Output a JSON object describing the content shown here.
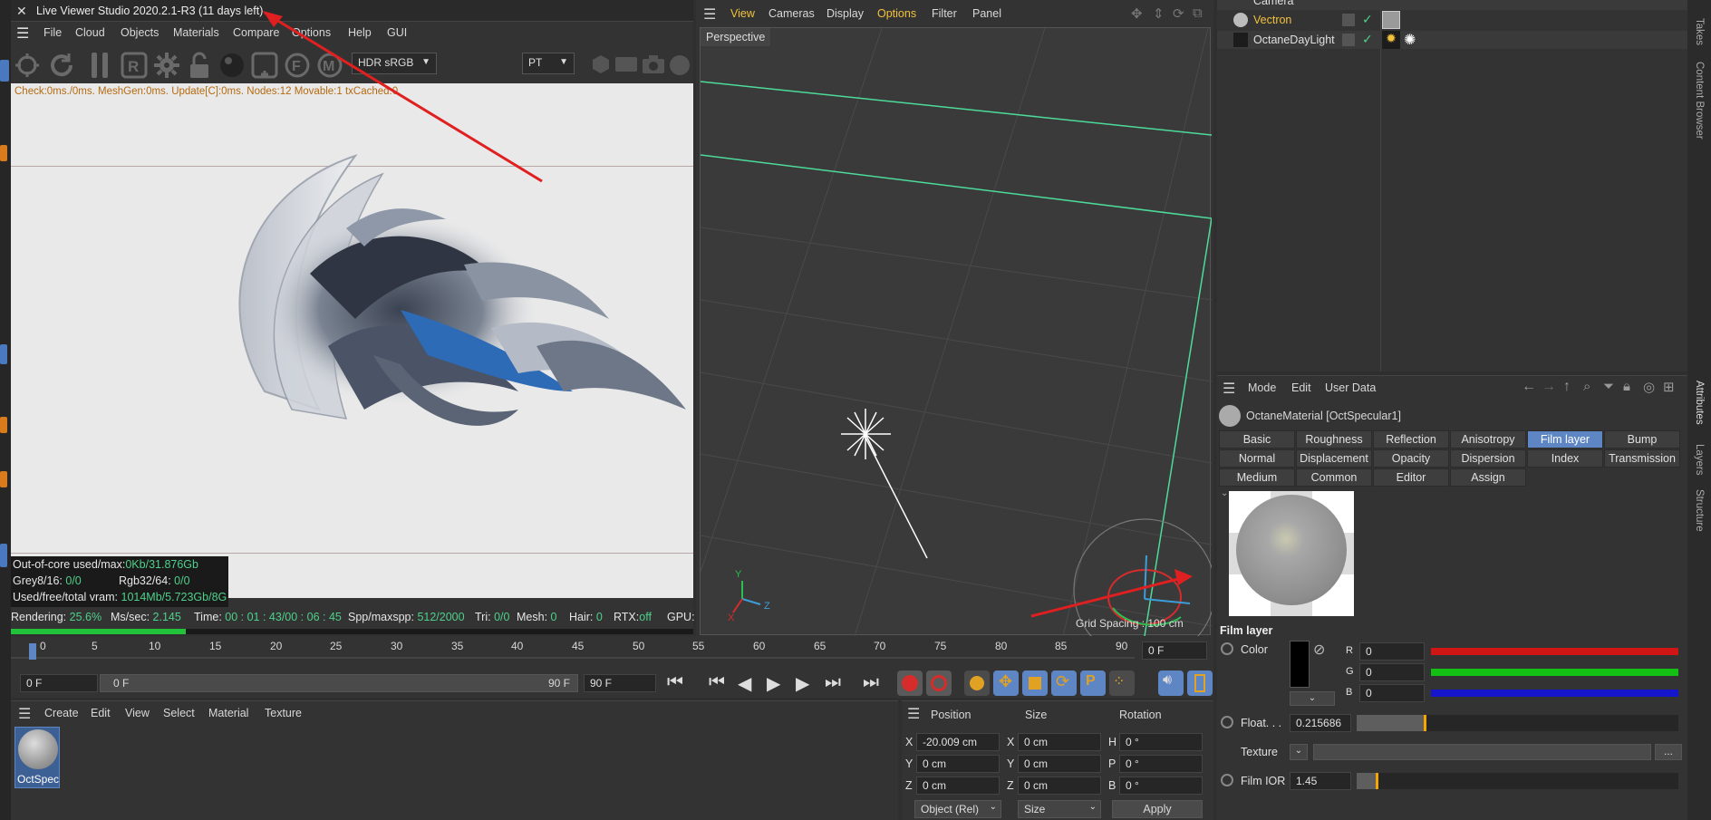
{
  "live_viewer": {
    "title": "Live Viewer Studio 2020.2.1-R3 (11 days left)",
    "menu": [
      "File",
      "Cloud",
      "Objects",
      "Materials",
      "Compare",
      "Options",
      "Help",
      "GUI"
    ],
    "hdr_select": "HDR sRGB",
    "mode_select": "PT",
    "debug_line": "Check:0ms./0ms. MeshGen:0ms. Update[C]:0ms. Nodes:12 Movable:1 txCached:0",
    "stats": {
      "outofcore_label": "Out-of-core used/max:",
      "outofcore_value": "0Kb/31.876Gb",
      "grey_label": "Grey8/16:",
      "grey_value": "0/0",
      "rgb_label": "Rgb32/64:",
      "rgb_value": "0/0",
      "vram_label": "Used/free/total vram:",
      "vram_value": "1014Mb/5.723Gb/8G"
    },
    "status": {
      "rendering_label": "Rendering:",
      "rendering_value": "25.6%",
      "mssec_label": "Ms/sec:",
      "mssec_value": "2.145",
      "time_label": "Time:",
      "time_value": "00 : 01 : 43/00 : 06 : 45",
      "spp_label": "Spp/maxspp:",
      "spp_value": "512/2000",
      "tri_label": "Tri:",
      "tri_value": "0/0",
      "mesh_label": "Mesh:",
      "mesh_value": "0",
      "hair_label": "Hair:",
      "hair_value": "0",
      "rtx_label": "RTX:",
      "rtx_value": "off",
      "gpu_label": "GPU:"
    },
    "progress": 0.256
  },
  "viewport": {
    "menu": [
      "View",
      "Cameras",
      "Display",
      "Options",
      "Filter",
      "Panel"
    ],
    "active_menu": "Options",
    "camera_label": "Perspective",
    "grid_spacing": "Grid Spacing : 100 cm",
    "axis_x": "X",
    "axis_y": "Y",
    "axis_z": "Z"
  },
  "objects": [
    {
      "name": "Camera",
      "color": "#e0e0e0"
    },
    {
      "name": "Vectron",
      "color": "#f2c23c"
    },
    {
      "name": "OctaneDayLight",
      "color": "#e0e0e0"
    }
  ],
  "side_tabs_top": [
    "Takes",
    "Content Browser"
  ],
  "side_tabs_bottom": [
    "Attributes",
    "Layers",
    "Structure"
  ],
  "attributes": {
    "menu": [
      "Mode",
      "Edit",
      "User Data"
    ],
    "material_name": "OctaneMaterial [OctSpecular1]",
    "tabs_row1": [
      "Basic",
      "Roughness",
      "Reflection",
      "Anisotropy",
      "Film layer",
      "Bump"
    ],
    "tabs_row2": [
      "Normal",
      "Displacement",
      "Opacity",
      "Dispersion",
      "Index",
      "Transmission"
    ],
    "tabs_row3": [
      "Medium",
      "Common",
      "Editor",
      "Assign"
    ],
    "active_tab": "Film layer",
    "section_title": "Film layer",
    "color_label": "Color",
    "r_label": "R",
    "r_value": "0",
    "g_label": "G",
    "g_value": "0",
    "b_label": "B",
    "b_value": "0",
    "float_label": "Float. . .",
    "float_value": "0.215686",
    "float_fill": 0.215686,
    "texture_label": "Texture",
    "texture_btn": "...",
    "filmior_label": "Film IOR",
    "filmior_value": "1.45",
    "colors": {
      "r": "#d01515",
      "g": "#14c014",
      "b": "#1515cc"
    }
  },
  "timeline": {
    "ticks": [
      "0",
      "5",
      "10",
      "15",
      "20",
      "25",
      "30",
      "35",
      "40",
      "45",
      "50",
      "55",
      "60",
      "65",
      "70",
      "75",
      "80",
      "85",
      "90"
    ],
    "current_frame": "0 F",
    "start_frame": "0 F",
    "range_start": "0 F",
    "range_end": "90 F",
    "end_frame": "90 F"
  },
  "material_manager": {
    "menu": [
      "Create",
      "Edit",
      "View",
      "Select",
      "Material",
      "Texture"
    ],
    "material_label": "OctSpec"
  },
  "coordinates": {
    "headers": [
      "Position",
      "Size",
      "Rotation"
    ],
    "rows": [
      {
        "a": "X",
        "pos": "-20.009 cm",
        "b": "X",
        "size": "0 cm",
        "c": "H",
        "rot": "0 °"
      },
      {
        "a": "Y",
        "pos": "0 cm",
        "b": "Y",
        "size": "0 cm",
        "c": "P",
        "rot": "0 °"
      },
      {
        "a": "Z",
        "pos": "0 cm",
        "b": "Z",
        "size": "0 cm",
        "c": "B",
        "rot": "0 °"
      }
    ],
    "mode_select": "Object (Rel)",
    "size_select": "Size",
    "apply": "Apply"
  }
}
